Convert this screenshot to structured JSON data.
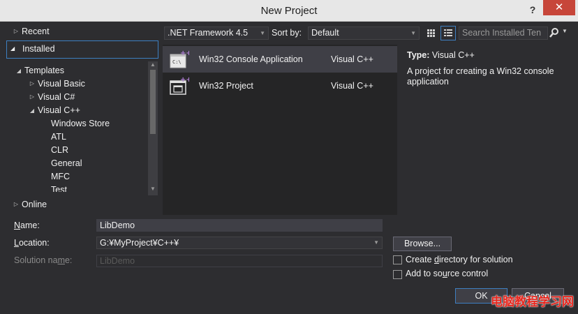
{
  "window": {
    "title": "New Project",
    "help_label": "?",
    "close_label": "✕"
  },
  "tree": {
    "recent": "Recent",
    "installed": "Installed",
    "templates": "Templates",
    "visual_basic": "Visual Basic",
    "visual_csharp": "Visual C#",
    "visual_cpp": "Visual C++",
    "cpp_children": [
      "Windows Store",
      "ATL",
      "CLR",
      "General",
      "MFC",
      "Test"
    ],
    "online": "Online"
  },
  "toolbar": {
    "framework": ".NET Framework 4.5",
    "sort_by_label": "Sort by:",
    "sort_value": "Default",
    "search_placeholder": "Search Installed Ten"
  },
  "templates": [
    {
      "name": "Win32 Console Application",
      "language": "Visual C++",
      "selected": true
    },
    {
      "name": "Win32 Project",
      "language": "Visual C++",
      "selected": false
    }
  ],
  "description": {
    "type_label": "Type:",
    "type_value": "Visual C++",
    "text": "A project for creating a Win32 console application"
  },
  "form": {
    "name_label_u": "N",
    "name_label_rest": "ame:",
    "name_value": "LibDemo",
    "location_label_u": "L",
    "location_label_rest": "ocation:",
    "location_value": "G:¥MyProject¥C++¥",
    "solution_label_pre": "Solution na",
    "solution_label_u": "m",
    "solution_label_post": "e:",
    "solution_value": "LibDemo",
    "browse_label": "Browse...",
    "create_dir_pre": "Create ",
    "create_dir_u": "d",
    "create_dir_post": "irectory for solution",
    "source_ctrl_pre": "Add to so",
    "source_ctrl_u": "u",
    "source_ctrl_post": "rce control",
    "create_dir_checked": false,
    "source_ctrl_checked": false
  },
  "buttons": {
    "ok": "OK",
    "cancel": "Cancel"
  },
  "watermark": "电脑教程学习网",
  "colors": {
    "background": "#2d2d30",
    "accent": "#3e7fc1",
    "close": "#c7463a",
    "watermark": "#e8261d"
  }
}
